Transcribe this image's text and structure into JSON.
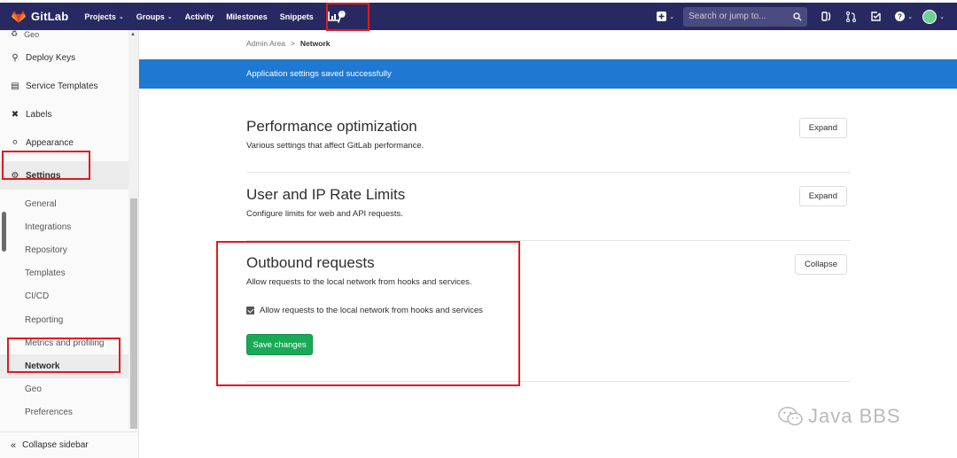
{
  "topbar": {
    "brand": "GitLab",
    "nav": [
      {
        "label": "Projects",
        "dropdown": true
      },
      {
        "label": "Groups",
        "dropdown": true
      },
      {
        "label": "Activity",
        "dropdown": false
      },
      {
        "label": "Milestones",
        "dropdown": false
      },
      {
        "label": "Snippets",
        "dropdown": false
      }
    ],
    "search_placeholder": "Search or jump to..."
  },
  "breadcrumb": {
    "parent": "Admin Area",
    "separator": ">",
    "current": "Network"
  },
  "flash": "Application settings saved successfully",
  "sidebar": {
    "geo_top": "Geo",
    "items": [
      {
        "label": "Deploy Keys",
        "icon": "key-icon"
      },
      {
        "label": "Service Templates",
        "icon": "template-icon"
      },
      {
        "label": "Labels",
        "icon": "labels-icon"
      },
      {
        "label": "Appearance",
        "icon": "palette-icon"
      },
      {
        "label": "Settings",
        "icon": "gear-icon"
      }
    ],
    "sub_items": [
      "General",
      "Integrations",
      "Repository",
      "Templates",
      "CI/CD",
      "Reporting",
      "Metrics and profiling",
      "Network",
      "Geo",
      "Preferences"
    ],
    "collapse_label": "Collapse sidebar"
  },
  "sections": {
    "performance": {
      "title": "Performance optimization",
      "desc": "Various settings that affect GitLab performance.",
      "button": "Expand"
    },
    "rate_limits": {
      "title": "User and IP Rate Limits",
      "desc": "Configure limits for web and API requests.",
      "button": "Expand"
    },
    "outbound": {
      "title": "Outbound requests",
      "desc": "Allow requests to the local network from hooks and services.",
      "button": "Collapse",
      "checkbox_label": "Allow requests to the local network from hooks and services",
      "checkbox_checked": true,
      "save_label": "Save changes"
    }
  },
  "watermark": "Java BBS",
  "colors": {
    "navbar": "#292961",
    "flash": "#1f78d1",
    "save": "#1aaa55",
    "highlight": "#e1191f"
  }
}
